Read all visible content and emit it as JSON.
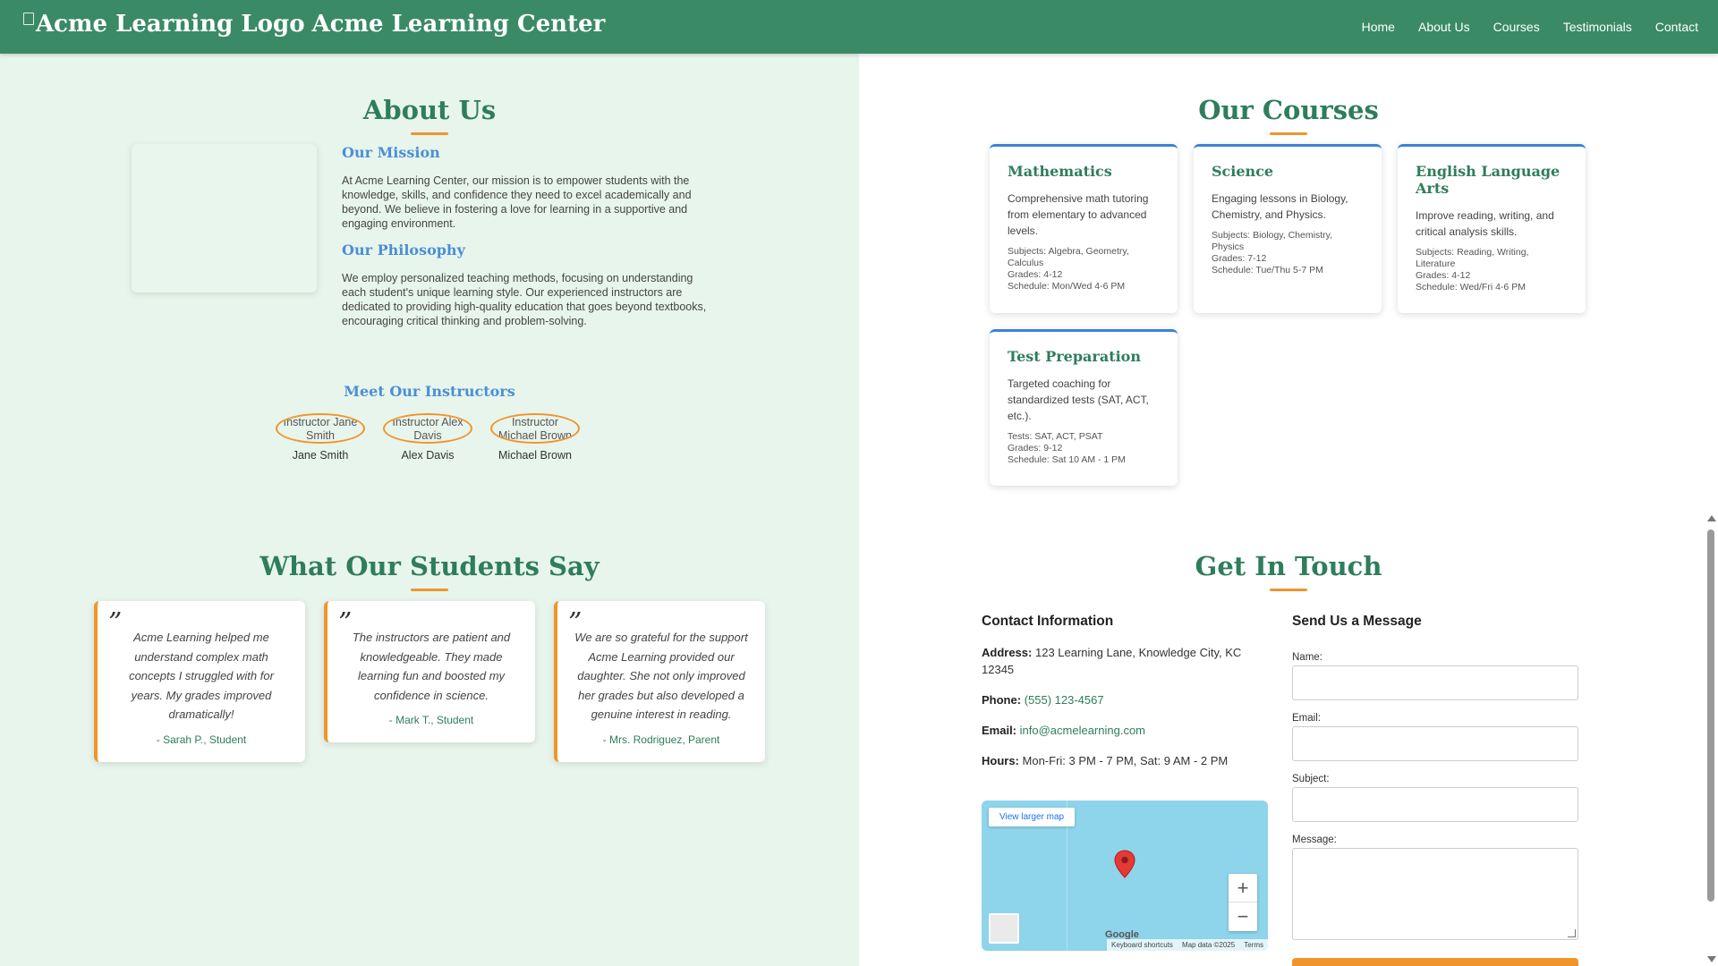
{
  "header": {
    "logo_alt": "Acme Learning Logo",
    "site_title": "Acme Learning Center",
    "nav": [
      "Home",
      "About Us",
      "Courses",
      "Testimonials",
      "Contact"
    ]
  },
  "about": {
    "title": "About Us",
    "mission_title": "Our Mission",
    "mission_text": "At Acme Learning Center, our mission is to empower students with the knowledge, skills, and confidence they need to excel academically and beyond. We believe in fostering a love for learning in a supportive and engaging environment.",
    "philosophy_title": "Our Philosophy",
    "philosophy_text": "We employ personalized teaching methods, focusing on understanding each student's unique learning style. Our experienced instructors are dedicated to providing high-quality education that goes beyond textbooks, encouraging critical thinking and problem-solving.",
    "instructors_title": "Meet Our Instructors",
    "instructors": [
      {
        "alt": "Instructor Jane Smith",
        "name": "Jane Smith"
      },
      {
        "alt": "Instructor Alex Davis",
        "name": "Alex Davis"
      },
      {
        "alt": "Instructor Michael Brown",
        "name": "Michael Brown"
      }
    ]
  },
  "courses": {
    "title": "Our Courses",
    "items": [
      {
        "name": "Mathematics",
        "desc": "Comprehensive math tutoring from elementary to advanced levels.",
        "line1": "Subjects: Algebra, Geometry, Calculus",
        "line2": "Grades: 4-12",
        "line3": "Schedule: Mon/Wed 4-6 PM"
      },
      {
        "name": "Science",
        "desc": "Engaging lessons in Biology, Chemistry, and Physics.",
        "line1": "Subjects: Biology, Chemistry, Physics",
        "line2": "Grades: 7-12",
        "line3": "Schedule: Tue/Thu 5-7 PM"
      },
      {
        "name": "English Language Arts",
        "desc": "Improve reading, writing, and critical analysis skills.",
        "line1": "Subjects: Reading, Writing, Literature",
        "line2": "Grades: 4-12",
        "line3": "Schedule: Wed/Fri 4-6 PM"
      },
      {
        "name": "Test Preparation",
        "desc": "Targeted coaching for standardized tests (SAT, ACT, etc.).",
        "line1": "Tests: SAT, ACT, PSAT",
        "line2": "Grades: 9-12",
        "line3": "Schedule: Sat 10 AM - 1 PM"
      }
    ]
  },
  "testimonials": {
    "title": "What Our Students Say",
    "quote_mark": "”",
    "items": [
      {
        "quote": "Acme Learning helped me understand complex math concepts I struggled with for years. My grades improved dramatically!",
        "author": "- Sarah P., Student"
      },
      {
        "quote": "The instructors are patient and knowledgeable. They made learning fun and boosted my confidence in science.",
        "author": "- Mark T., Student"
      },
      {
        "quote": "We are so grateful for the support Acme Learning provided our daughter. She not only improved her grades but also developed a genuine interest in reading.",
        "author": "- Mrs. Rodriguez, Parent"
      }
    ]
  },
  "contact": {
    "title": "Get In Touch",
    "info_title": "Contact Information",
    "address_label": "Address:",
    "address": "123 Learning Lane, Knowledge City, KC 12345",
    "phone_label": "Phone:",
    "phone": "(555) 123-4567",
    "email_label": "Email:",
    "email": "info@acmelearning.com",
    "hours_label": "Hours:",
    "hours": "Mon-Fri: 3 PM - 7 PM, Sat: 9 AM - 2 PM",
    "map": {
      "view_larger": "View larger map",
      "zoom_in": "+",
      "zoom_out": "−",
      "google": "Google",
      "keyboard": "Keyboard shortcuts",
      "map_data": "Map data ©2025",
      "terms": "Terms"
    },
    "form_title": "Send Us a Message",
    "name_label": "Name:",
    "email_field_label": "Email:",
    "subject_label": "Subject:",
    "message_label": "Message:"
  },
  "colors": {
    "header_bg": "#3a8a66",
    "heading_green": "#2e7d5b",
    "accent_orange": "#f0952c",
    "subheading_blue": "#4a8fd6",
    "section_mint": "#e8f5ec"
  }
}
